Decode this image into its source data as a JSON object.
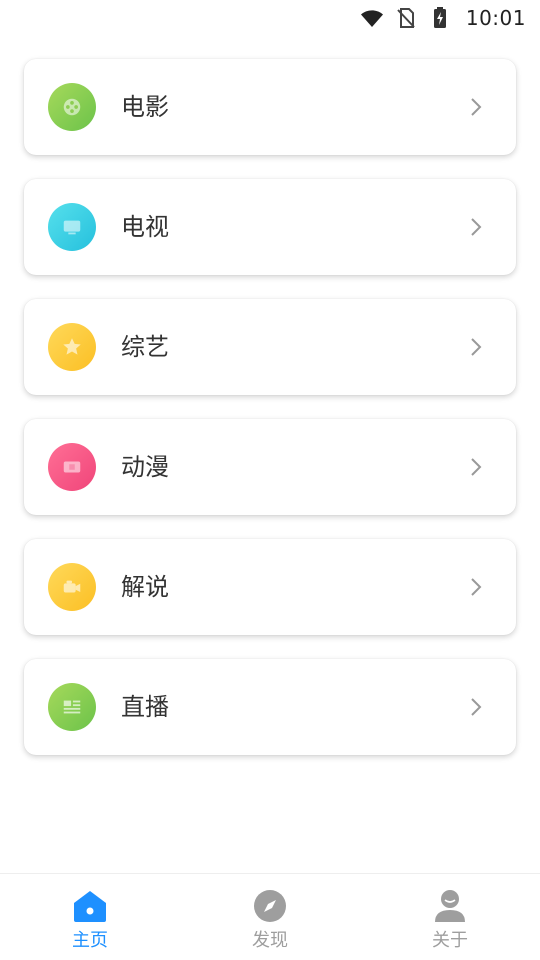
{
  "status_bar": {
    "time": "10:01",
    "icons": [
      "wifi-icon",
      "no-sim-icon",
      "battery-charging-icon"
    ]
  },
  "categories": [
    {
      "label": "电影",
      "icon": "film-reel-icon",
      "color_start": "#a6d95b",
      "color_end": "#6cc34a"
    },
    {
      "label": "电视",
      "icon": "tv-icon",
      "color_start": "#56e0ec",
      "color_end": "#25c0dd"
    },
    {
      "label": "综艺",
      "icon": "star-icon",
      "color_start": "#ffd95a",
      "color_end": "#fbbf24"
    },
    {
      "label": "动漫",
      "icon": "ticket-icon",
      "color_start": "#ff6f95",
      "color_end": "#f0457a"
    },
    {
      "label": "解说",
      "icon": "video-camera-icon",
      "color_start": "#ffd95a",
      "color_end": "#fbbf24"
    },
    {
      "label": "直播",
      "icon": "news-icon",
      "color_start": "#a6d95b",
      "color_end": "#6cc34a"
    }
  ],
  "bottom_nav": {
    "items": [
      {
        "label": "主页",
        "icon": "home-icon",
        "active": true
      },
      {
        "label": "发现",
        "icon": "compass-icon",
        "active": false
      },
      {
        "label": "关于",
        "icon": "user-icon",
        "active": false
      }
    ],
    "active_color": "#1e90ff",
    "inactive_color": "#9e9e9e"
  }
}
